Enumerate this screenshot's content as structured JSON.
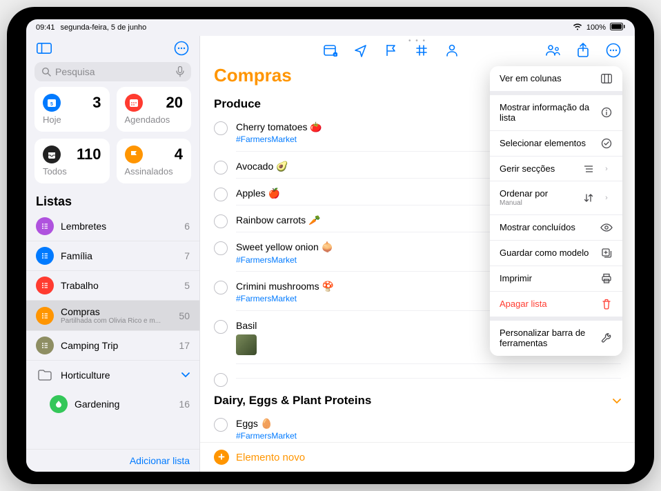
{
  "statusbar": {
    "time": "09:41",
    "date": "segunda-feira, 5 de junho",
    "battery": "100%"
  },
  "sidebar": {
    "search_placeholder": "Pesquisa",
    "smart": [
      {
        "label": "Hoje",
        "count": "3",
        "color": "#007aff",
        "ico": "cal"
      },
      {
        "label": "Agendados",
        "count": "20",
        "color": "#ff3b30",
        "ico": "calgrid"
      },
      {
        "label": "Todos",
        "count": "110",
        "color": "#222",
        "ico": "tray"
      },
      {
        "label": "Assinalados",
        "count": "4",
        "color": "#ff9500",
        "ico": "flag"
      }
    ],
    "lists_header": "Listas",
    "lists": [
      {
        "title": "Lembretes",
        "count": "6",
        "color": "#af52de"
      },
      {
        "title": "Família",
        "count": "7",
        "color": "#007aff"
      },
      {
        "title": "Trabalho",
        "count": "5",
        "color": "#ff3b30"
      },
      {
        "title": "Compras",
        "count": "50",
        "color": "#ff9500",
        "sub": "Partilhada com Olivia Rico e m...",
        "selected": true
      },
      {
        "title": "Camping Trip",
        "count": "17",
        "color": "#8e8e63"
      }
    ],
    "folder": {
      "title": "Horticulture"
    },
    "folder_lists": [
      {
        "title": "Gardening",
        "count": "16",
        "color": "#34c759"
      }
    ],
    "add_list": "Adicionar lista"
  },
  "main": {
    "title": "Compras",
    "sections": [
      {
        "name": "Produce",
        "items": [
          {
            "title": "Cherry tomatoes 🍅",
            "tag": "#FarmersMarket"
          },
          {
            "title": "Avocado 🥑"
          },
          {
            "title": "Apples 🍎"
          },
          {
            "title": "Rainbow carrots 🥕"
          },
          {
            "title": "Sweet yellow onion 🧅",
            "tag": "#FarmersMarket"
          },
          {
            "title": "Crimini mushrooms 🍄",
            "tag": "#FarmersMarket"
          },
          {
            "title": "Basil",
            "img": true
          },
          {
            "title": ""
          }
        ]
      },
      {
        "name": "Dairy, Eggs & Plant Proteins",
        "collapsible": true,
        "items": [
          {
            "title": "Eggs 🥚",
            "tag": "#FarmersMarket"
          }
        ]
      }
    ],
    "new_item": "Elemento novo"
  },
  "menu": {
    "items": [
      {
        "label": "Ver em colunas",
        "icon": "columns"
      },
      {
        "sep": true
      },
      {
        "label": "Mostrar informação da lista",
        "icon": "info"
      },
      {
        "label": "Selecionar elementos",
        "icon": "check"
      },
      {
        "label": "Gerir secções",
        "icon": "section",
        "chev": true
      },
      {
        "label": "Ordenar por",
        "sub": "Manual",
        "icon": "sort",
        "chev": true
      },
      {
        "label": "Mostrar concluídos",
        "icon": "eye"
      },
      {
        "label": "Guardar como modelo",
        "icon": "template"
      },
      {
        "label": "Imprimir",
        "icon": "print"
      },
      {
        "label": "Apagar lista",
        "icon": "trash",
        "danger": true
      },
      {
        "sep": true
      },
      {
        "label": "Personalizar barra de ferramentas",
        "icon": "wrench"
      }
    ]
  }
}
